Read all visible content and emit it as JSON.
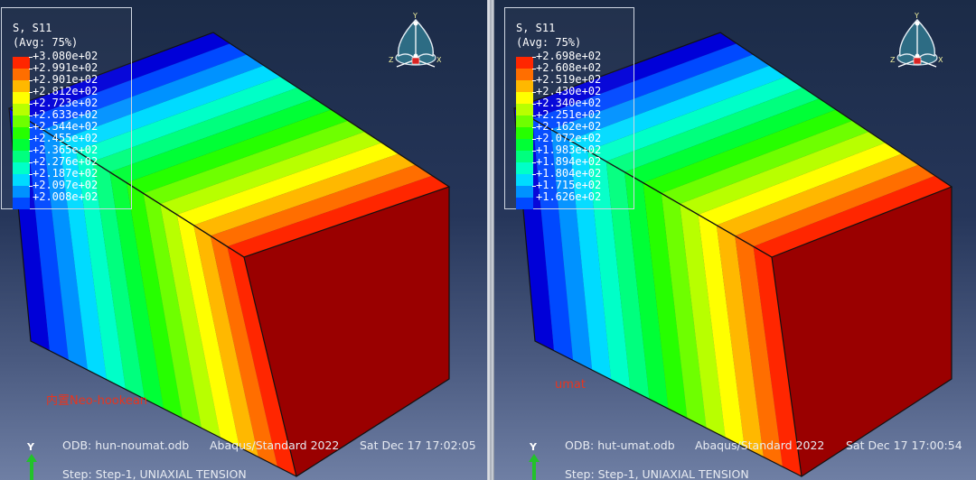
{
  "colors": {
    "contour": [
      "#0000d8",
      "#0049ff",
      "#0092ff",
      "#00dbff",
      "#00ffc8",
      "#00ff7e",
      "#00ff36",
      "#26ff00",
      "#6eff00",
      "#b8ff00",
      "#ffff00",
      "#ffb800",
      "#ff6e00",
      "#ff2600"
    ],
    "red_label": "#e8351e",
    "axis_y": "#22c22a"
  },
  "left": {
    "legend": {
      "title": "S, S11",
      "subtitle": "(Avg: 75%)",
      "values": [
        "+3.080e+02",
        "+2.991e+02",
        "+2.901e+02",
        "+2.812e+02",
        "+2.723e+02",
        "+2.633e+02",
        "+2.544e+02",
        "+2.455e+02",
        "+2.365e+02",
        "+2.276e+02",
        "+2.187e+02",
        "+2.097e+02",
        "+2.008e+02"
      ]
    },
    "triad": {
      "y": "Y",
      "z": "Z",
      "x": "X"
    },
    "model_label": "内置Neo-hookean",
    "footer": {
      "odb": "ODB: hun-noumat.odb",
      "solver": "Abaqus/Standard 2022",
      "date": "Sat Dec 17 17:02:05",
      "step": "Step: Step-1, UNIAXIAL TENSION"
    },
    "axis_label": "Y"
  },
  "right": {
    "legend": {
      "title": "S, S11",
      "subtitle": "(Avg: 75%)",
      "values": [
        "+2.698e+02",
        "+2.608e+02",
        "+2.519e+02",
        "+2.430e+02",
        "+2.340e+02",
        "+2.251e+02",
        "+2.162e+02",
        "+2.072e+02",
        "+1.983e+02",
        "+1.894e+02",
        "+1.804e+02",
        "+1.715e+02",
        "+1.626e+02"
      ]
    },
    "triad": {
      "y": "Y",
      "z": "Z",
      "x": "X"
    },
    "model_label": "umat",
    "footer": {
      "odb": "ODB: hut-umat.odb",
      "solver": "Abaqus/Standard 2022",
      "date": "Sat Dec 17 17:00:54",
      "step": "Step: Step-1, UNIAXIAL TENSION"
    },
    "axis_label": "Y"
  }
}
